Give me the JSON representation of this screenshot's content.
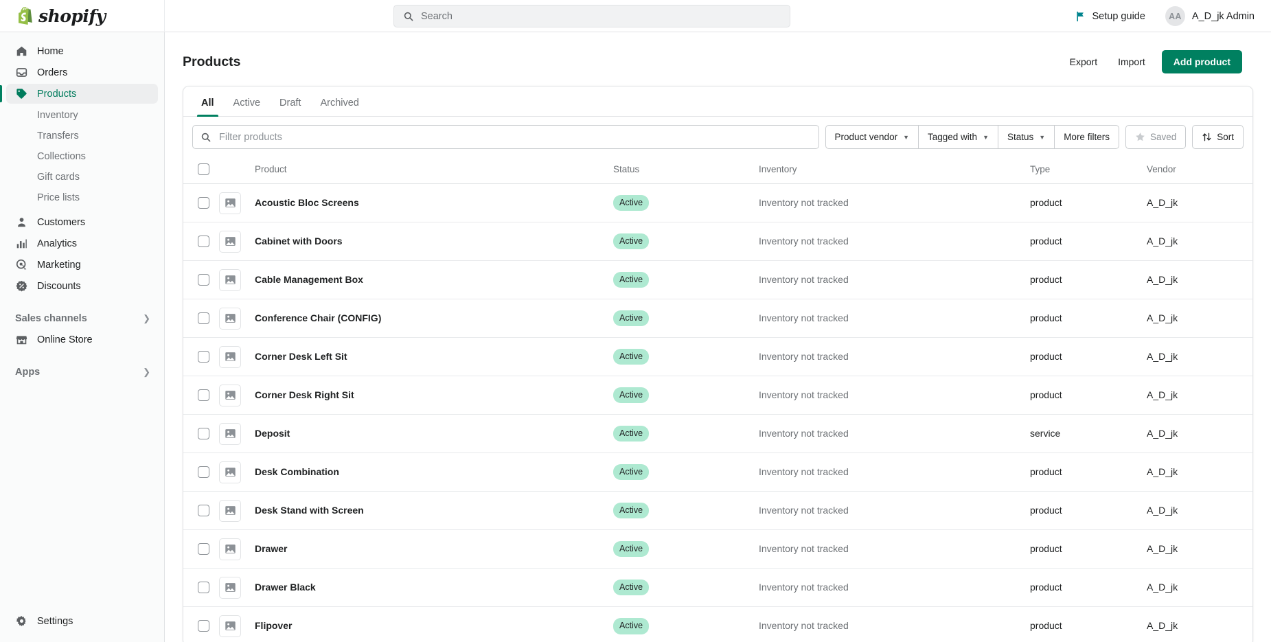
{
  "topbar": {
    "brand": "shopify",
    "search_placeholder": "Search",
    "search_value": "",
    "setup_guide_label": "Setup guide",
    "avatar_initials": "AA",
    "user_name": "A_D_jk Admin"
  },
  "sidebar": {
    "items": [
      {
        "label": "Home",
        "icon": "home-icon",
        "active": false
      },
      {
        "label": "Orders",
        "icon": "orders-icon",
        "active": false
      },
      {
        "label": "Products",
        "icon": "products-tag-icon",
        "active": true
      }
    ],
    "sub_items": [
      {
        "label": "Inventory"
      },
      {
        "label": "Transfers"
      },
      {
        "label": "Collections"
      },
      {
        "label": "Gift cards"
      },
      {
        "label": "Price lists"
      }
    ],
    "items2": [
      {
        "label": "Customers",
        "icon": "customer-icon"
      },
      {
        "label": "Analytics",
        "icon": "analytics-icon"
      },
      {
        "label": "Marketing",
        "icon": "marketing-icon"
      },
      {
        "label": "Discounts",
        "icon": "discounts-icon"
      }
    ],
    "sales_channels": {
      "label": "Sales channels"
    },
    "online_store": {
      "label": "Online Store",
      "icon": "store-icon"
    },
    "apps": {
      "label": "Apps"
    },
    "settings": {
      "label": "Settings",
      "icon": "gear-icon"
    }
  },
  "page": {
    "title": "Products",
    "export_label": "Export",
    "import_label": "Import",
    "add_product_label": "Add product"
  },
  "tabs": [
    {
      "label": "All",
      "active": true
    },
    {
      "label": "Active",
      "active": false
    },
    {
      "label": "Draft",
      "active": false
    },
    {
      "label": "Archived",
      "active": false
    }
  ],
  "filters": {
    "search_placeholder": "Filter products",
    "search_value": "",
    "product_vendor_label": "Product vendor",
    "tagged_with_label": "Tagged with",
    "status_label": "Status",
    "more_filters_label": "More filters",
    "saved_label": "Saved",
    "sort_label": "Sort"
  },
  "table": {
    "columns": [
      "Product",
      "Status",
      "Inventory",
      "Type",
      "Vendor"
    ],
    "rows": [
      {
        "product": "Acoustic Bloc Screens",
        "status": "Active",
        "inventory": "Inventory not tracked",
        "type": "product",
        "vendor": "A_D_jk"
      },
      {
        "product": "Cabinet with Doors",
        "status": "Active",
        "inventory": "Inventory not tracked",
        "type": "product",
        "vendor": "A_D_jk"
      },
      {
        "product": "Cable Management Box",
        "status": "Active",
        "inventory": "Inventory not tracked",
        "type": "product",
        "vendor": "A_D_jk"
      },
      {
        "product": "Conference Chair (CONFIG)",
        "status": "Active",
        "inventory": "Inventory not tracked",
        "type": "product",
        "vendor": "A_D_jk"
      },
      {
        "product": "Corner Desk Left Sit",
        "status": "Active",
        "inventory": "Inventory not tracked",
        "type": "product",
        "vendor": "A_D_jk"
      },
      {
        "product": "Corner Desk Right Sit",
        "status": "Active",
        "inventory": "Inventory not tracked",
        "type": "product",
        "vendor": "A_D_jk"
      },
      {
        "product": "Deposit",
        "status": "Active",
        "inventory": "Inventory not tracked",
        "type": "service",
        "vendor": "A_D_jk"
      },
      {
        "product": "Desk Combination",
        "status": "Active",
        "inventory": "Inventory not tracked",
        "type": "product",
        "vendor": "A_D_jk"
      },
      {
        "product": "Desk Stand with Screen",
        "status": "Active",
        "inventory": "Inventory not tracked",
        "type": "product",
        "vendor": "A_D_jk"
      },
      {
        "product": "Drawer",
        "status": "Active",
        "inventory": "Inventory not tracked",
        "type": "product",
        "vendor": "A_D_jk"
      },
      {
        "product": "Drawer Black",
        "status": "Active",
        "inventory": "Inventory not tracked",
        "type": "product",
        "vendor": "A_D_jk"
      },
      {
        "product": "Flipover",
        "status": "Active",
        "inventory": "Inventory not tracked",
        "type": "product",
        "vendor": "A_D_jk"
      }
    ]
  },
  "colors": {
    "brand_green": "#008060",
    "badge_green": "#aee9d1",
    "accent_teal": "#00848e"
  }
}
